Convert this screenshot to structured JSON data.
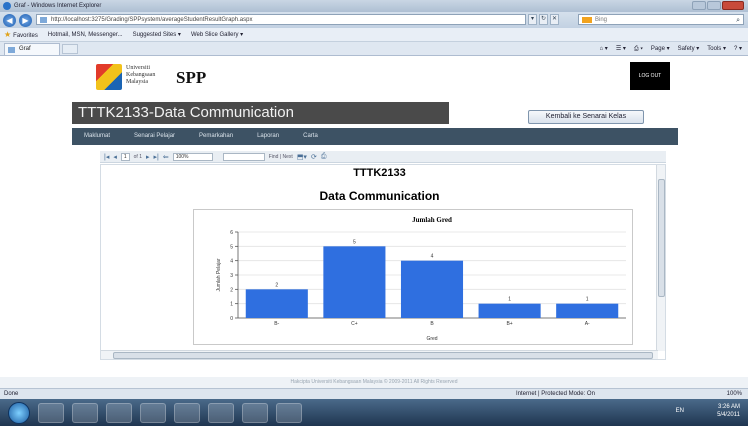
{
  "browser": {
    "window_title": "Graf - Windows Internet Explorer",
    "url": "http://localhost:3275/Grading/SPPsystem/averageStudentResultGraph.aspx",
    "search_engine": "Bing",
    "tab_title": "Graf",
    "favorites_label": "Favorites",
    "favorites_items": [
      "Hotmail, MSN, Messenger...",
      "Suggested Sites ▾",
      "Web Slice Gallery ▾"
    ],
    "command_items": [
      "Page ▾",
      "Safety ▾",
      "Tools ▾"
    ],
    "status_left": "Done",
    "status_zone": "Internet | Protected Mode: On",
    "zoom": "100%"
  },
  "header": {
    "uni_line1": "Universiti",
    "uni_line2": "Kebangsaan",
    "uni_line3": "Malaysia",
    "app_name": "SPP",
    "logout_label": "LOG OUT",
    "course_title": "TTTK2133-Data Communication",
    "back_button": "Kembali ke Senarai Kelas"
  },
  "menu": [
    {
      "label": "Maklumat"
    },
    {
      "label": "Senarai Pelajar"
    },
    {
      "label": "Pemarkahan"
    },
    {
      "label": "Laporan"
    },
    {
      "label": "Carta"
    }
  ],
  "report_toolbar": {
    "page_current": "1",
    "page_of": "of 1",
    "zoom_value": "100%",
    "find_label": "Find | Next"
  },
  "report": {
    "course_code": "TTTK2133",
    "course_name": "Data Communication"
  },
  "chart_data": {
    "type": "bar",
    "title": "Jumlah Gred",
    "xlabel": "Gred",
    "ylabel": "Jumlah Pelajar",
    "categories": [
      "B-",
      "C+",
      "B",
      "B+",
      "A-"
    ],
    "values": [
      2,
      5,
      4,
      1,
      1
    ],
    "ylim": [
      0,
      6
    ],
    "yticks": [
      0,
      1,
      2,
      3,
      4,
      5,
      6
    ],
    "bar_color": "#2f6fe0",
    "grid": true
  },
  "footer_text": "Hakcipta Universiti Kebangsaan Malaysia © 2009-2011 All Rights Reserved",
  "taskbar": {
    "lang": "EN",
    "time": "3:26 AM",
    "date": "5/4/2011"
  }
}
